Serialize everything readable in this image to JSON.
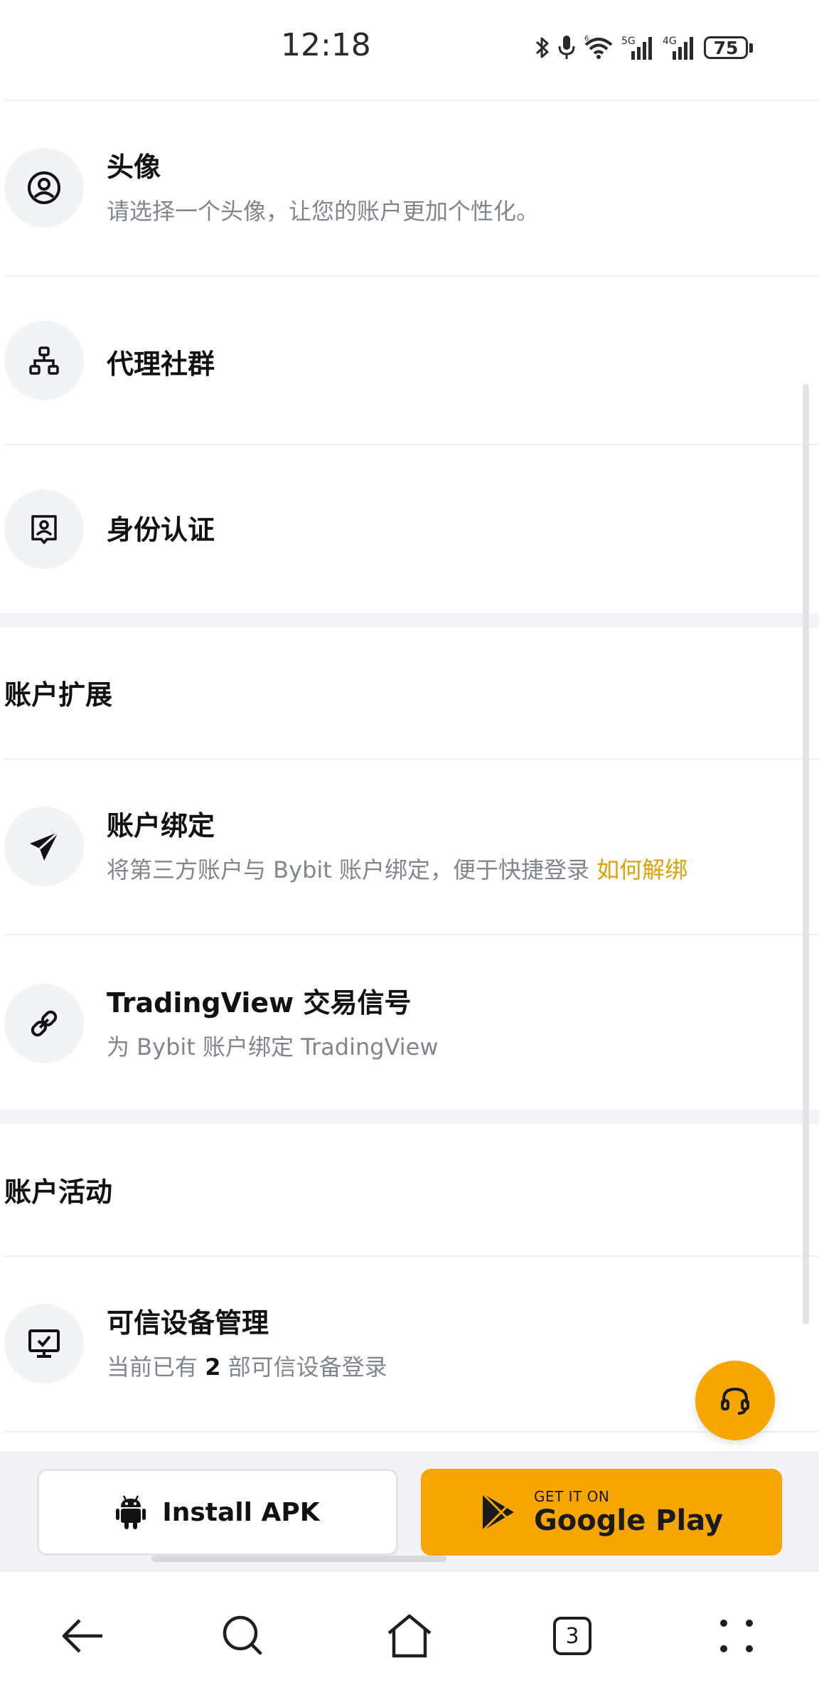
{
  "status_bar": {
    "time": "12:18",
    "signal_1": "5G",
    "signal_2": "4G",
    "battery": "75",
    "icons": [
      "bluetooth-icon",
      "mic-icon",
      "wifi-icon",
      "signal-5g-icon",
      "signal-4g-icon",
      "battery-icon"
    ]
  },
  "profile_items": [
    {
      "title": "头像",
      "desc": "请选择一个头像，让您的账户更加个性化。",
      "icon": "avatar-icon"
    },
    {
      "title": "代理社群",
      "icon": "hierarchy-icon"
    },
    {
      "title": "身份认证",
      "icon": "id-badge-icon"
    }
  ],
  "extension_section": {
    "title": "账户扩展",
    "items": [
      {
        "title": "账户绑定",
        "desc": "将第三方账户与 Bybit 账户绑定，便于快捷登录",
        "link": "如何解绑",
        "icon": "paper-plane-icon"
      },
      {
        "title": "TradingView 交易信号",
        "desc": "为 Bybit 账户绑定 TradingView",
        "icon": "link-icon"
      }
    ]
  },
  "activity_section": {
    "title": "账户活动",
    "items": [
      {
        "title": "可信设备管理",
        "desc_prefix": "当前已有",
        "desc_count": "2",
        "desc_suffix": "部可信设备登录",
        "icon": "monitor-check-icon"
      }
    ]
  },
  "support_button": {
    "icon": "headset-icon"
  },
  "download_bar": {
    "apk_label": "Install APK",
    "gplay_small": "GET IT ON",
    "gplay_big": "Google Play",
    "brand_color": "#f7a600"
  },
  "nav_bar": {
    "tab_count": "3",
    "items": [
      "back-arrow-icon",
      "search-icon",
      "home-icon",
      "tabs-icon",
      "menu-dots-icon"
    ]
  },
  "colors": {
    "accent": "#f7a600",
    "link": "#e0a006",
    "text_primary": "#121214",
    "text_secondary": "#81858c"
  }
}
